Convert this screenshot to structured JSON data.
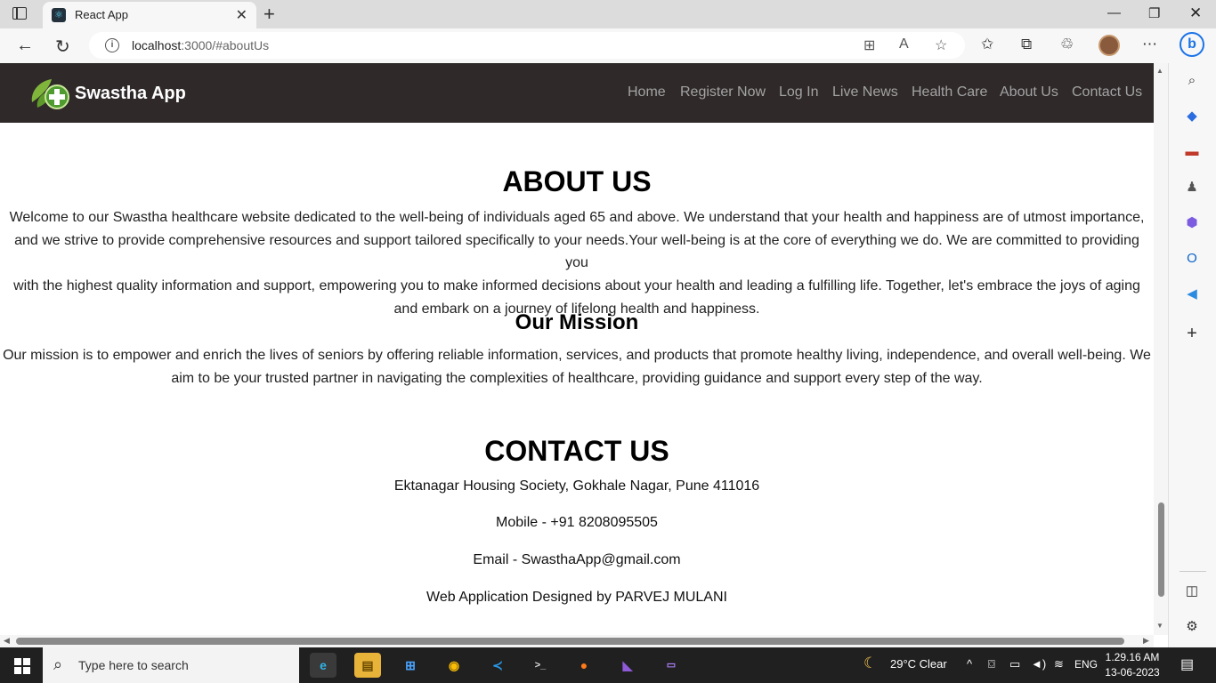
{
  "browser": {
    "tab_title": "React App",
    "url_host": "localhost",
    "url_port_path": ":3000/#aboutUs"
  },
  "site": {
    "brand": "Swastha App",
    "nav": [
      "Home",
      "Register Now",
      "Log In",
      "Live News",
      "Health Care",
      "About Us",
      "Contact Us"
    ]
  },
  "about": {
    "title": "ABOUT US",
    "lines": [
      "Welcome to our Swastha healthcare website dedicated to the well-being of individuals aged 65 and above. We understand that your health and happiness are of utmost importance,",
      "and we strive to provide comprehensive resources and support tailored specifically to your needs.Your well-being is at the core of everything we do. We are committed to providing you",
      "with the highest quality information and support, empowering you to make informed decisions about your health and leading a fulfilling life. Together, let's embrace the joys of aging",
      "and embark on a journey of lifelong health and happiness."
    ]
  },
  "mission": {
    "title": "Our Mission",
    "lines": [
      "Our mission is to empower and enrich the lives of seniors by offering reliable information, services, and products that promote healthy living, independence, and overall well-being. We",
      "aim to be your trusted partner in navigating the complexities of healthcare, providing guidance and support every step of the way."
    ]
  },
  "contact": {
    "title": "CONTACT US",
    "address": "Ektanagar Housing Society, Gokhale Nagar, Pune 411016",
    "mobile": "Mobile - +91 8208095505",
    "email": "Email - SwasthaApp@gmail.com",
    "credit": "Web Application Designed by PARVEJ MULANI"
  },
  "taskbar": {
    "search_placeholder": "Type here to search",
    "weather": "29°C  Clear",
    "language": "ENG",
    "time": "1.29.16 AM",
    "date": "13-06-2023"
  },
  "colors": {
    "navbar": "#2f2929",
    "nav_link": "#a3a3a3",
    "accent": "#1a73e8"
  }
}
